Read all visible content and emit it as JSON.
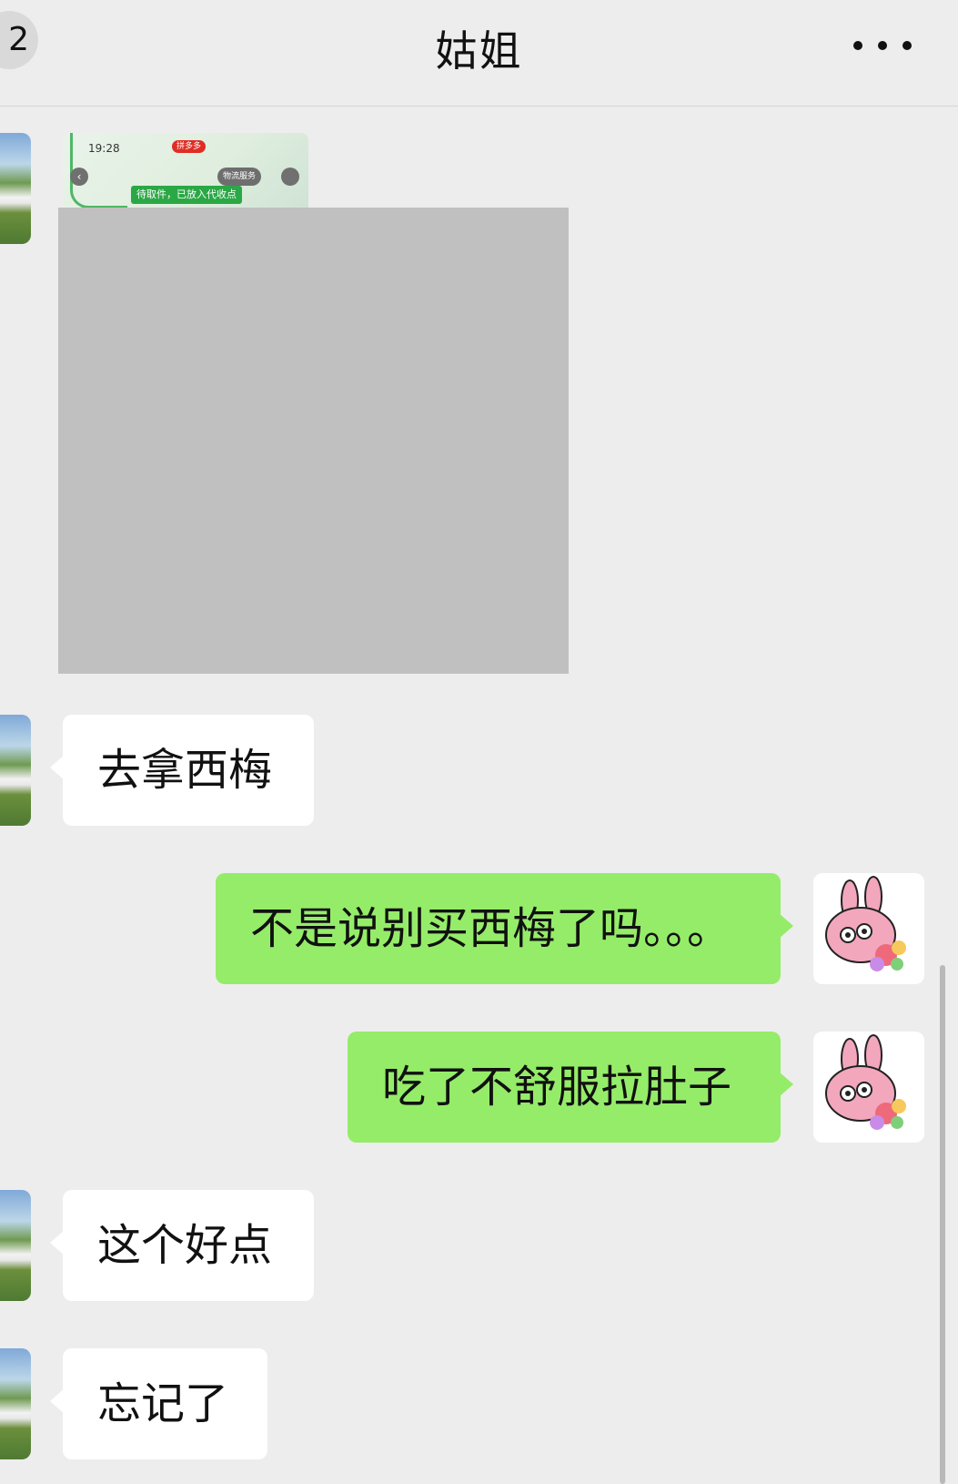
{
  "header": {
    "back_badge": "2",
    "title": "姑姐"
  },
  "thumbnail": {
    "time": "19:28",
    "brand_badge": "拼多多",
    "service_label": "物流服务",
    "status_label": "待取件，已放入代收点"
  },
  "messages": [
    {
      "side": "in",
      "text": "去拿西梅"
    },
    {
      "side": "out",
      "text": "不是说别买西梅了吗。。。"
    },
    {
      "side": "out",
      "text": "吃了不舒服拉肚子"
    },
    {
      "side": "in",
      "text": "这个好点"
    },
    {
      "side": "in",
      "text": "忘记了"
    }
  ]
}
